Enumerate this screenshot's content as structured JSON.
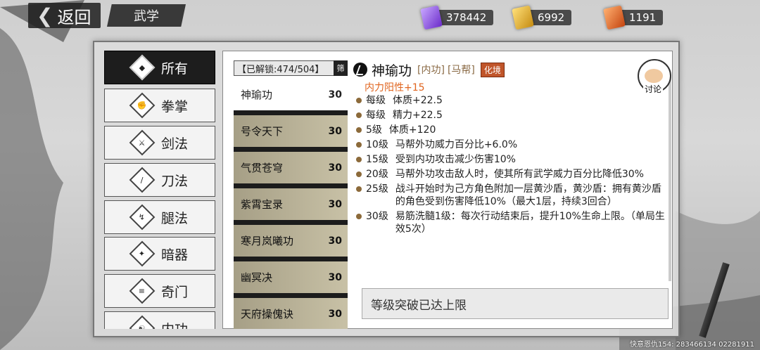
{
  "header": {
    "back_label": "返回",
    "section_title": "武学",
    "currencies": [
      {
        "icon": "purple-scroll-icon",
        "value": "378442"
      },
      {
        "icon": "gold-scroll-icon",
        "value": "6992"
      },
      {
        "icon": "orange-scroll-icon",
        "value": "1191"
      }
    ]
  },
  "categories": [
    {
      "label": "所有",
      "icon": "all-icon",
      "active": true
    },
    {
      "label": "拳掌",
      "icon": "fist-icon"
    },
    {
      "label": "剑法",
      "icon": "sword-icon"
    },
    {
      "label": "刀法",
      "icon": "blade-icon"
    },
    {
      "label": "腿法",
      "icon": "leg-icon"
    },
    {
      "label": "暗器",
      "icon": "shuriken-icon"
    },
    {
      "label": "奇门",
      "icon": "odd-weapon-icon"
    },
    {
      "label": "内功",
      "icon": "inner-power-icon"
    }
  ],
  "unlock": {
    "text": "【已解锁:474/504】",
    "filter_label": "筛"
  },
  "skills": [
    {
      "name": "神瑜功",
      "level": "30",
      "active": true
    },
    {
      "name": "号令天下",
      "level": "30"
    },
    {
      "name": "气贯苍穹",
      "level": "30"
    },
    {
      "name": "紫霄宝录",
      "level": "30"
    },
    {
      "name": "寒月岚曦功",
      "level": "30"
    },
    {
      "name": "幽冥决",
      "level": "30"
    },
    {
      "name": "天府操傀诀",
      "level": "30"
    }
  ],
  "detail": {
    "name": "神瑜功",
    "tag1": "[内功]",
    "tag2": "[马帮]",
    "realm": "化境",
    "inner_note": "内力阳性+15",
    "lines": [
      {
        "level": "每级",
        "text": "体质+22.5"
      },
      {
        "level": "每级",
        "text": "精力+22.5"
      },
      {
        "level": "5级",
        "text": "体质+120"
      },
      {
        "level": "10级",
        "text": "马帮外功威力百分比+6.0%"
      },
      {
        "level": "15级",
        "text": "受到内功攻击减少伤害10%"
      },
      {
        "level": "20级",
        "text": "马帮外功攻击敌人时，使其所有武学威力百分比降低30%"
      },
      {
        "level": "25级",
        "text": "战斗开始时为己方角色附加一层黄沙盾，黄沙盾：拥有黄沙盾的角色受到伤害降低10%（最大1层，持续3回合）"
      },
      {
        "level": "30级",
        "text": "易筋洗髓1级：每次行动结束后，提升10%生命上限。（单局生效5次）"
      }
    ],
    "limit_text": "等级突破已达上限",
    "discuss_label": "讨论"
  },
  "footer": {
    "id_text": "快意恩仇154: 283466134  02281911"
  }
}
